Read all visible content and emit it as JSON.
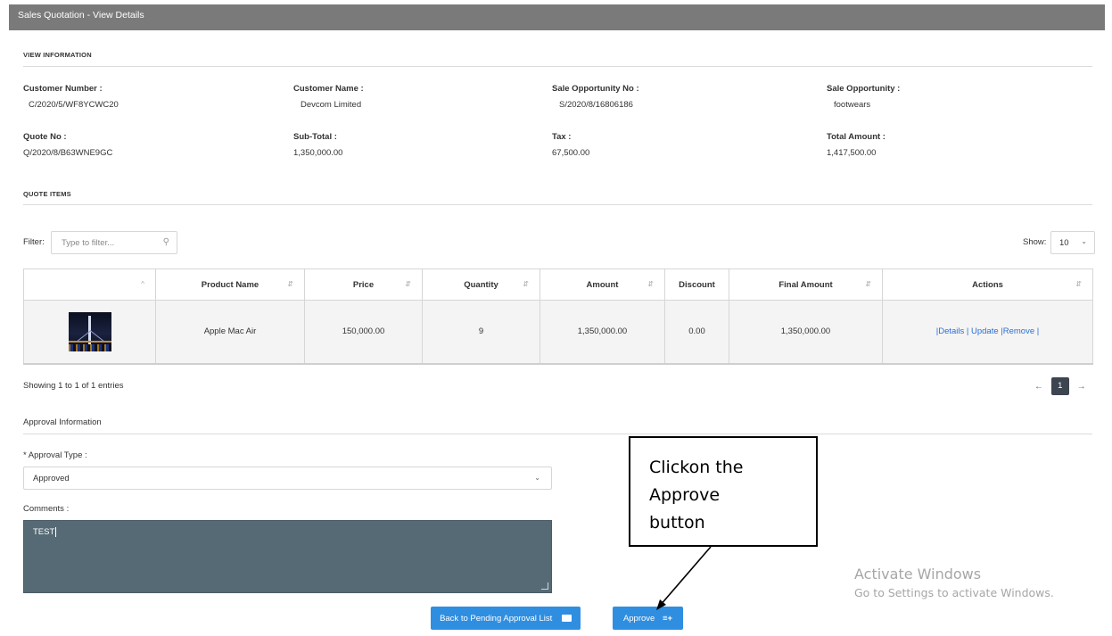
{
  "page": {
    "title": "Sales Quotation - View Details"
  },
  "view_information": {
    "heading": "VIEW INFORMATION",
    "fields": [
      {
        "label": "Customer Number :",
        "value": "C/2020/5/WF8YCWC20"
      },
      {
        "label": "Customer Name :",
        "value": "Devcom Limited"
      },
      {
        "label": "Sale Opportunity No :",
        "value": "S/2020/8/16806186"
      },
      {
        "label": "Sale Opportunity :",
        "value": "footwears"
      },
      {
        "label": "Quote No :",
        "value": "Q/2020/8/B63WNE9GC"
      },
      {
        "label": "Sub-Total :",
        "value": "1,350,000.00"
      },
      {
        "label": "Tax :",
        "value": "67,500.00"
      },
      {
        "label": "Total Amount :",
        "value": "1,417,500.00"
      }
    ]
  },
  "quote_items": {
    "heading": "QUOTE ITEMS",
    "filter_label": "Filter:",
    "filter_placeholder": "Type to filter...",
    "show_label": "Show:",
    "show_value": "10",
    "columns": [
      "",
      "Product Name",
      "Price",
      "Quantity",
      "Amount",
      "Discount",
      "Final Amount",
      "Actions"
    ],
    "rows": [
      {
        "image": "bridge-night-photo",
        "product_name": "Apple Mac Air",
        "price": "150,000.00",
        "quantity": "9",
        "amount": "1,350,000.00",
        "discount": "0.00",
        "final_amount": "1,350,000.00",
        "actions": "|Details | Update |Remove |"
      }
    ],
    "showing_text": "Showing 1 to 1 of 1 entries",
    "pagination": {
      "prev": "←",
      "current": "1",
      "next": "→"
    }
  },
  "approval": {
    "heading": "Approval Information",
    "type_label": "* Approval Type :",
    "type_value": "Approved",
    "comments_label": "Comments :",
    "comments_value": "TEST"
  },
  "buttons": {
    "back": "Back to Pending Approval List",
    "back_icon": "briefcase-icon",
    "approve": "Approve",
    "approve_icon": "list-add-icon"
  },
  "callout": {
    "lines": [
      "Clickon the",
      "Approve",
      "button"
    ]
  },
  "watermark": {
    "line1": "Activate Windows",
    "line2": "Go to Settings to activate Windows."
  },
  "colors": {
    "title_bar": "#7a7a7a",
    "primary_button": "#2f8ee0",
    "comments_bg": "#566a75",
    "link": "#2a6fd6"
  }
}
